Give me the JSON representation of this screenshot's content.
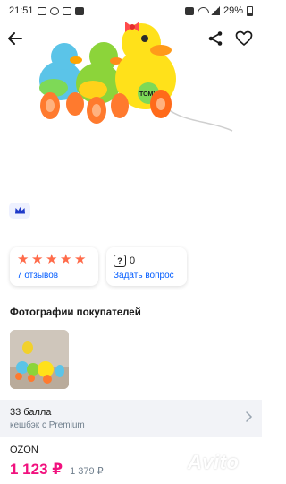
{
  "status_bar": {
    "time": "21:51",
    "battery": "29%"
  },
  "icons": {
    "back": "arrow-left-icon",
    "share": "share-icon",
    "favorite": "heart-outline-icon",
    "premium": "crown-icon",
    "question": "question-icon",
    "chevron": "chevron-right-icon"
  },
  "product": {
    "image_brand_mark": "TOMY"
  },
  "rating": {
    "stars": 5,
    "max_stars": 5,
    "reviews_label": "7 отзывов"
  },
  "questions": {
    "count": "0",
    "ask_label": "Задать вопрос"
  },
  "buyer_photos": {
    "title": "Фотографии покупателей"
  },
  "cashback": {
    "points": "33 балла",
    "subtitle": "кешбэк с Premium"
  },
  "seller": {
    "name": "OZON"
  },
  "price": {
    "current": "1 123 ₽",
    "old": "1 379 ₽"
  },
  "watermark": {
    "text": "Avito"
  },
  "colors": {
    "accent": "#005bff",
    "price": "#f1117e",
    "star": "#ff6b4a",
    "muted": "#707f8d"
  }
}
